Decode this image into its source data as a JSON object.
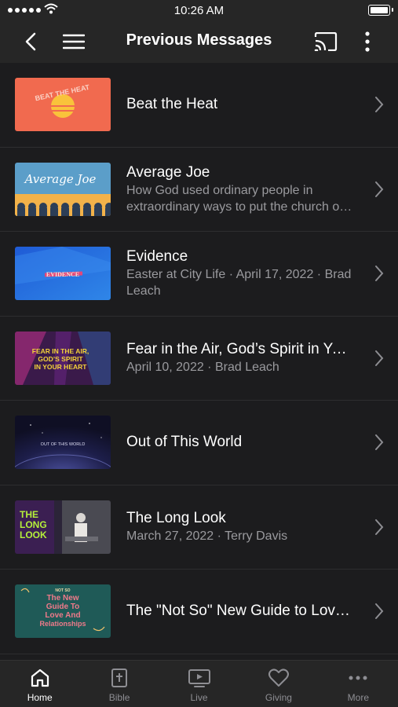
{
  "status_bar": {
    "time": "10:26 AM"
  },
  "nav": {
    "title": "Previous Messages"
  },
  "messages": [
    {
      "title": "Beat the Heat",
      "subtitle": "",
      "thumb_text": "BEAT THE HEAT"
    },
    {
      "title": "Average Joe",
      "subtitle": "How God used ordinary people in extraordinary ways to put the church on the map.",
      "thumb_text": "Average Joe"
    },
    {
      "title": "Evidence",
      "subtitle": "Easter at City Life · April 17, 2022 · Brad Leach",
      "thumb_text": "EVIDENCE"
    },
    {
      "title": "Fear in the Air, God’s Spirit in Your Heart",
      "subtitle": "April 10, 2022 · Brad Leach",
      "thumb_text": [
        "FEAR IN THE AIR,",
        "GOD’S SPIRIT",
        "IN YOUR HEART"
      ]
    },
    {
      "title": "Out of This World",
      "subtitle": "",
      "thumb_text": "OUT OF THIS WORLD"
    },
    {
      "title": "The Long Look",
      "subtitle": "March 27, 2022 · Terry Davis",
      "thumb_text": [
        "THE",
        "LONG",
        "LOOK"
      ]
    },
    {
      "title": "The \"Not So\" New Guide to Love and Relationships",
      "subtitle": "",
      "thumb_text": [
        "NOT SO",
        "The New",
        "Guide To",
        "Love And",
        "Relationships"
      ]
    }
  ],
  "tabs": [
    {
      "label": "Home",
      "icon": "home-icon",
      "active": true
    },
    {
      "label": "Bible",
      "icon": "bible-icon",
      "active": false
    },
    {
      "label": "Live",
      "icon": "live-tv-icon",
      "active": false
    },
    {
      "label": "Giving",
      "icon": "heart-icon",
      "active": false
    },
    {
      "label": "More",
      "icon": "more-dots-icon",
      "active": false
    }
  ],
  "colors": {
    "background": "#1c1c1e",
    "bar": "#262626",
    "subtitle": "#9a9a9e",
    "tab_inactive": "#8e8e93"
  }
}
